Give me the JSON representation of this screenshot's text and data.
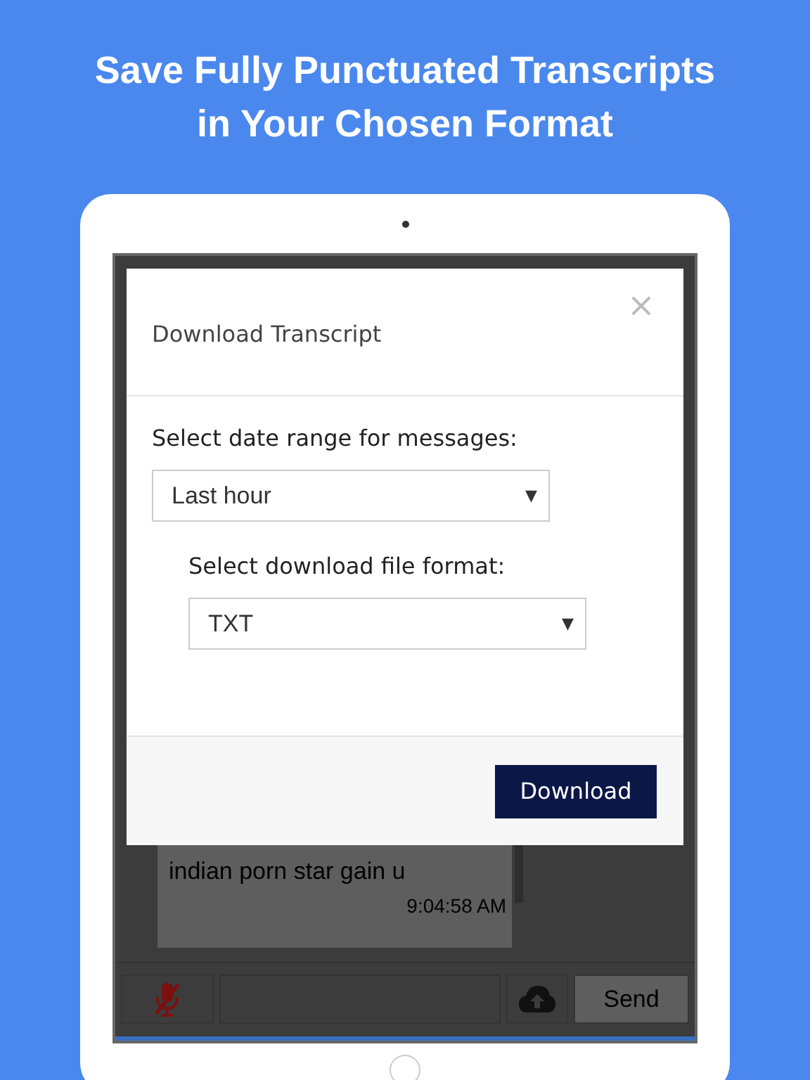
{
  "headline": [
    "Save Fully Punctuated Transcripts",
    "in Your Chosen Format"
  ],
  "dialog": {
    "title": "Download Transcript",
    "close": "×",
    "fields": [
      {
        "label": "Select date range for messages:",
        "value": "Last hour",
        "indented": false
      },
      {
        "label": "Select download file format:",
        "value": "TXT",
        "indented": true
      }
    ],
    "arrow": "▼",
    "button": "Download"
  },
  "chat": {
    "message": "indian porn star gain u",
    "time": "9:04:58 AM"
  },
  "input_bar": {
    "mic_muted": true,
    "send": "Send"
  }
}
